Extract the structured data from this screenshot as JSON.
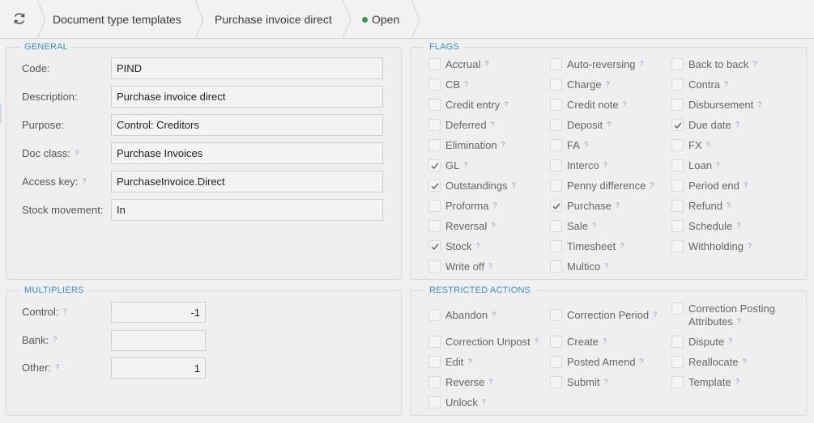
{
  "header": {
    "crumbs": [
      "Document type templates",
      "Purchase invoice direct"
    ],
    "status": "Open",
    "status_color": "#2e9e3e",
    "refresh_icon": "refresh-icon"
  },
  "general": {
    "title": "GENERAL",
    "fields": [
      {
        "label": "Code:",
        "value": "PIND",
        "help": false
      },
      {
        "label": "Description:",
        "value": "Purchase invoice direct",
        "help": false
      },
      {
        "label": "Purpose:",
        "value": "Control: Creditors",
        "help": false
      },
      {
        "label": "Doc class:",
        "value": "Purchase Invoices",
        "help": true
      },
      {
        "label": "Access key:",
        "value": "PurchaseInvoice.Direct",
        "help": true
      },
      {
        "label": "Stock movement:",
        "value": "In",
        "help": false
      }
    ]
  },
  "multipliers": {
    "title": "MULTIPLIERS",
    "fields": [
      {
        "label": "Control:",
        "value": "-1"
      },
      {
        "label": "Bank:",
        "value": ""
      },
      {
        "label": "Other:",
        "value": "1"
      }
    ]
  },
  "flags": {
    "title": "FLAGS",
    "columns": [
      [
        {
          "label": "Accrual",
          "checked": false
        },
        {
          "label": "CB",
          "checked": false
        },
        {
          "label": "Credit entry",
          "checked": false
        },
        {
          "label": "Deferred",
          "checked": false
        },
        {
          "label": "Elimination",
          "checked": false
        },
        {
          "label": "GL",
          "checked": true
        },
        {
          "label": "Outstandings",
          "checked": true
        },
        {
          "label": "Proforma",
          "checked": false
        },
        {
          "label": "Reversal",
          "checked": false
        },
        {
          "label": "Stock",
          "checked": true
        },
        {
          "label": "Write off",
          "checked": false
        }
      ],
      [
        {
          "label": "Auto-reversing",
          "checked": false
        },
        {
          "label": "Charge",
          "checked": false
        },
        {
          "label": "Credit note",
          "checked": false
        },
        {
          "label": "Deposit",
          "checked": false
        },
        {
          "label": "FA",
          "checked": false
        },
        {
          "label": "Interco",
          "checked": false
        },
        {
          "label": "Penny difference",
          "checked": false
        },
        {
          "label": "Purchase",
          "checked": true
        },
        {
          "label": "Sale",
          "checked": false
        },
        {
          "label": "Timesheet",
          "checked": false
        },
        {
          "label": "Multico",
          "checked": false
        }
      ],
      [
        {
          "label": "Back to back",
          "checked": false
        },
        {
          "label": "Contra",
          "checked": false
        },
        {
          "label": "Disbursement",
          "checked": false
        },
        {
          "label": "Due date",
          "checked": true
        },
        {
          "label": "FX",
          "checked": false
        },
        {
          "label": "Loan",
          "checked": false
        },
        {
          "label": "Period end",
          "checked": false
        },
        {
          "label": "Refund",
          "checked": false
        },
        {
          "label": "Schedule",
          "checked": false
        },
        {
          "label": "Withholding",
          "checked": false
        }
      ]
    ]
  },
  "restricted": {
    "title": "RESTRICTED ACTIONS",
    "columns": [
      [
        {
          "label": "Abandon",
          "checked": false
        },
        {
          "label": "Correction Unpost",
          "checked": false
        },
        {
          "label": "Edit",
          "checked": false
        },
        {
          "label": "Reverse",
          "checked": false
        },
        {
          "label": "Unlock",
          "checked": false
        }
      ],
      [
        {
          "label": "Correction Period",
          "checked": false
        },
        {
          "label": "Create",
          "checked": false
        },
        {
          "label": "Posted Amend",
          "checked": false
        },
        {
          "label": "Submit",
          "checked": false
        }
      ],
      [
        {
          "label": "Correction Posting Attributes",
          "checked": false
        },
        {
          "label": "Dispute",
          "checked": false
        },
        {
          "label": "Reallocate",
          "checked": false
        },
        {
          "label": "Template",
          "checked": false
        }
      ]
    ]
  },
  "help_mark": "?"
}
